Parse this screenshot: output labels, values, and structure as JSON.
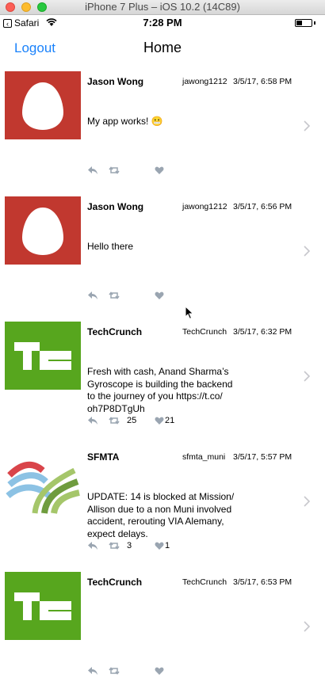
{
  "simulator": {
    "title": "iPhone 7 Plus – iOS 10.2 (14C89)"
  },
  "status_bar": {
    "back_app": "Safari",
    "time": "7:28 PM"
  },
  "nav": {
    "logout_label": "Logout",
    "title": "Home"
  },
  "colors": {
    "accent": "#1a82fb",
    "icon_gray": "#9aa5b1",
    "egg_bg": "#c1382f",
    "tc_bg": "#57a61e"
  },
  "tweets": [
    {
      "avatar": "egg",
      "name": "Jason Wong",
      "handle": "jawong1212",
      "time": "3/5/17, 6:58 PM",
      "text": "My app works! 😬",
      "retweets": "",
      "likes": ""
    },
    {
      "avatar": "egg",
      "name": "Jason Wong",
      "handle": "jawong1212",
      "time": "3/5/17, 6:56 PM",
      "text": "Hello there",
      "retweets": "",
      "likes": ""
    },
    {
      "avatar": "techcrunch",
      "name": "TechCrunch",
      "handle": "TechCrunch",
      "time": "3/5/17, 6:32 PM",
      "text": "Fresh with cash, Anand Sharma’s\nGyroscope is building the backend\nto the journey of you https://t.co/\noh7P8DTgUh",
      "retweets": "25",
      "likes": "21"
    },
    {
      "avatar": "sfmta",
      "name": "SFMTA",
      "handle": "sfmta_muni",
      "time": "3/5/17, 5:57 PM",
      "text": "UPDATE:  14 is blocked at Mission/\nAllison due to a non Muni involved\naccident, rerouting VIA Alemany,\nexpect delays.",
      "retweets": "3",
      "likes": "1"
    },
    {
      "avatar": "techcrunch",
      "name": "TechCrunch",
      "handle": "TechCrunch",
      "time": "3/5/17, 6:53 PM",
      "text": "",
      "retweets": "",
      "likes": ""
    }
  ]
}
